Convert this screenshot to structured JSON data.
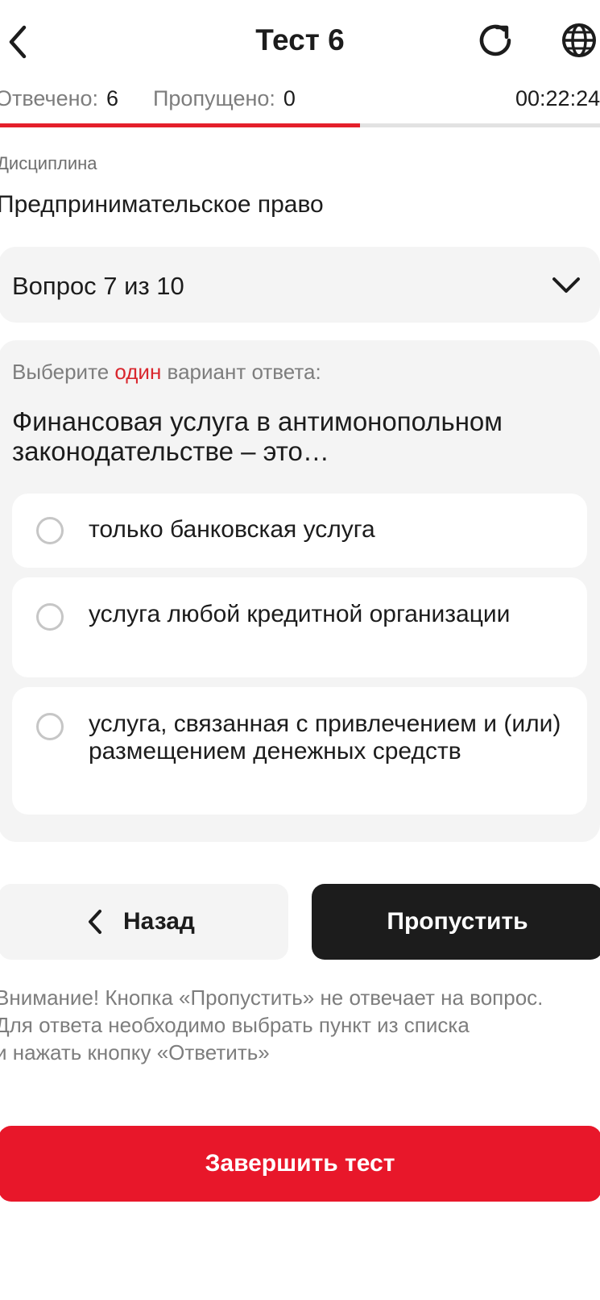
{
  "header": {
    "title": "Тест 6",
    "back_icon": "chevron-left-icon",
    "refresh_icon": "refresh-icon",
    "language_icon": "globe-icon"
  },
  "stats": {
    "answered_label": "Отвечено:",
    "answered_value": "6",
    "skipped_label": "Пропущено:",
    "skipped_value": "0",
    "timer": "00:22:24",
    "progress_fraction": 0.6
  },
  "discipline": {
    "label": "Дисциплина",
    "value": "Предпринимательское право"
  },
  "question_selector": {
    "label": "Вопрос 7 из 10"
  },
  "question": {
    "instruction_before": "Выберите ",
    "instruction_accent": "один",
    "instruction_after": " вариант ответа:",
    "text": "Финансовая услуга в антимонопольном законодательстве – это…",
    "options": [
      "только банковская услуга",
      "услуга любой кредитной организации",
      "услуга, связанная с привлечением и (или) размещением денежных средств"
    ]
  },
  "buttons": {
    "back_label": "Назад",
    "skip_label": "Пропустить",
    "finish_label": "Завершить тест"
  },
  "notice": "Внимание! Кнопка «Пропустить» не отвечает на вопрос.\nДля ответа необходимо выбрать пункт из списка\nи нажать кнопку «Ответить»",
  "colors": {
    "accent": "#e8172a",
    "dark_button": "#1c1c1c",
    "surface": "#f4f4f4"
  }
}
